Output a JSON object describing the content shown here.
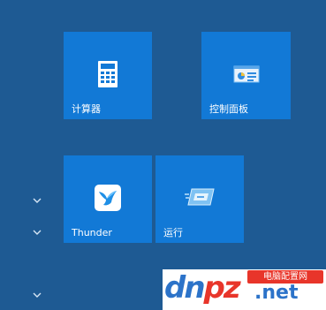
{
  "tiles": [
    {
      "label": "计算器",
      "icon": "calculator-icon"
    },
    {
      "label": "控制面板",
      "icon": "control-panel-icon"
    },
    {
      "label": "Thunder",
      "icon": "thunder-bird-icon"
    },
    {
      "label": "运行",
      "icon": "run-icon"
    }
  ],
  "group_toggles": [
    "chevron-down-icon",
    "chevron-down-icon",
    "chevron-down-icon"
  ],
  "watermark": {
    "logo_part1": "dn",
    "logo_part2": "pz",
    "site_name": "电脑配置网",
    "domain_suffix": ".net"
  },
  "colors": {
    "background": "#1e5a93",
    "tile": "#1279d6",
    "watermark_red": "#e8352a",
    "watermark_blue": "#2c73c9"
  }
}
